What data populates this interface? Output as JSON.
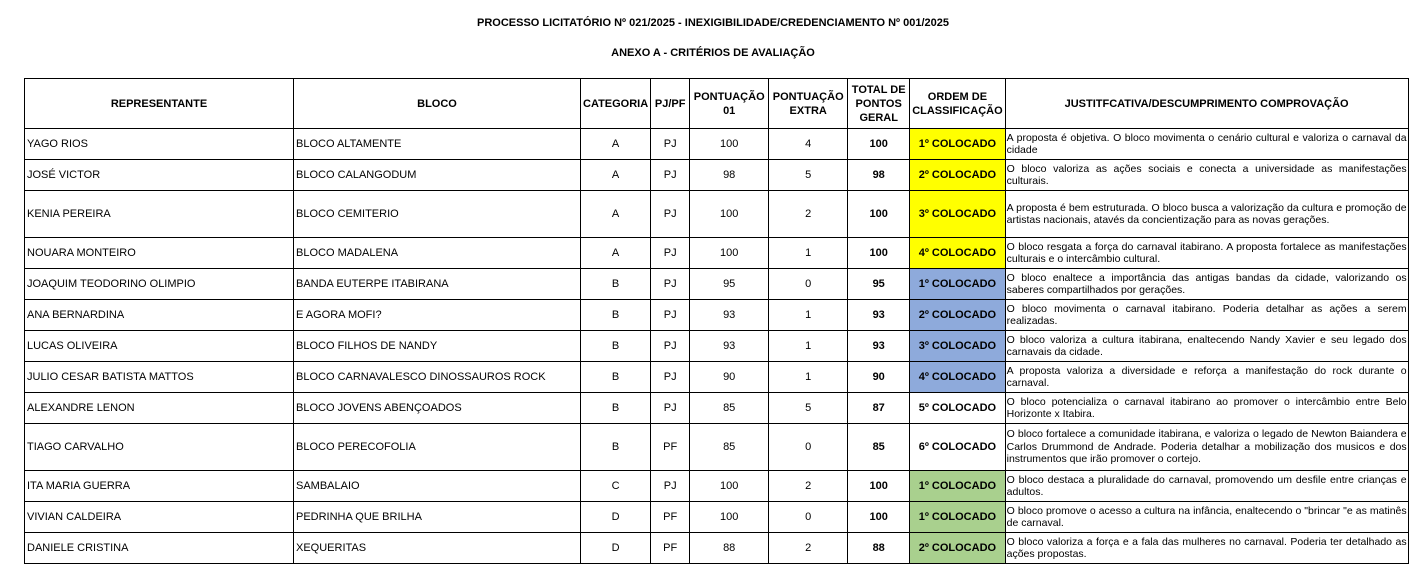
{
  "document": {
    "title": "PROCESSO LICITATÓRIO Nº 021/2025 - INEXIGIBILIDADE/CREDENCIAMENTO Nº 001/2025",
    "subtitle": "ANEXO A  -  CRITÉRIOS DE AVALIAÇÃO"
  },
  "table": {
    "headers": {
      "representante": "REPRESENTANTE",
      "bloco": "BLOCO",
      "categoria": "CATEGORIA",
      "pj_pf": "PJ/PF",
      "pontuacao_01": "PONTUAÇÃO 01",
      "pontuacao_extra": "PONTUAÇÃO EXTRA",
      "total": "TOTAL DE PONTOS GERAL",
      "ordem": "ORDEM DE CLASSIFICAÇÃO",
      "justificativa": "JUSTITFCATIVA/DESCUMPRIMENTO COMPROVAÇÃO"
    },
    "rank_colors": {
      "yellow": "#ffff00",
      "blue": "#8eaadb",
      "green": "#a9d08e",
      "none": "#ffffff"
    },
    "rows": [
      {
        "representante": "YAGO RIOS",
        "bloco": "BLOCO ALTAMENTE",
        "categoria": "A",
        "pj_pf": "PJ",
        "pontuacao_01": "100",
        "pontuacao_extra": "4",
        "total": "100",
        "ordem": "1º COLOCADO",
        "rank_color": "yellow",
        "justificativa": "A proposta é objetiva. O bloco movimenta o cenário cultural e valoriza o carnaval da cidade"
      },
      {
        "representante": "JOSÉ VICTOR",
        "bloco": "BLOCO CALANGODUM",
        "categoria": "A",
        "pj_pf": "PJ",
        "pontuacao_01": "98",
        "pontuacao_extra": "5",
        "total": "98",
        "ordem": "2º COLOCADO",
        "rank_color": "yellow",
        "justificativa": "O bloco valoriza as ações sociais e conecta a universidade as manifestações culturais."
      },
      {
        "representante": "KENIA PEREIRA",
        "bloco": "BLOCO CEMITERIO",
        "categoria": "A",
        "pj_pf": "PJ",
        "pontuacao_01": "100",
        "pontuacao_extra": "2",
        "total": "100",
        "ordem": "3º COLOCADO",
        "rank_color": "yellow",
        "justificativa": " A proposta é bem estruturada. O bloco busca a valorização da cultura e promoção de artistas nacionais, atavés da concientização para as novas gerações."
      },
      {
        "representante": "NOUARA MONTEIRO",
        "bloco": "BLOCO MADALENA",
        "categoria": "A",
        "pj_pf": "PJ",
        "pontuacao_01": "100",
        "pontuacao_extra": "1",
        "total": "100",
        "ordem": "4º COLOCADO",
        "rank_color": "yellow",
        "justificativa": "O bloco resgata a força do carnaval itabirano. A proposta fortalece as manifestações culturais  e o intercâmbio cultural."
      },
      {
        "representante": "JOAQUIM TEODORINO OLIMPIO",
        "bloco": "BANDA EUTERPE ITABIRANA",
        "categoria": "B",
        "pj_pf": "PJ",
        "pontuacao_01": "95",
        "pontuacao_extra": "0",
        "total": "95",
        "ordem": "1º COLOCADO",
        "rank_color": "blue",
        "justificativa": "O bloco enaltece a importância das antigas bandas da cidade, valorizando os saberes compartilhados  por gerações."
      },
      {
        "representante": "ANA BERNARDINA",
        "bloco": "E AGORA MOFI?",
        "categoria": "B",
        "pj_pf": "PJ",
        "pontuacao_01": "93",
        "pontuacao_extra": "1",
        "total": "93",
        "ordem": "2º COLOCADO",
        "rank_color": "blue",
        "justificativa": "O bloco movimenta o carnaval itabirano. Poderia detalhar as ações a serem realizadas."
      },
      {
        "representante": "LUCAS OLIVEIRA",
        "bloco": "BLOCO FILHOS DE NANDY",
        "categoria": "B",
        "pj_pf": "PJ",
        "pontuacao_01": "93",
        "pontuacao_extra": "1",
        "total": "93",
        "ordem": "3º COLOCADO",
        "rank_color": "blue",
        "justificativa": "O bloco valoriza a cultura itabirana, enaltecendo Nandy Xavier e seu legado dos carnavais da cidade."
      },
      {
        "representante": "JULIO CESAR BATISTA MATTOS",
        "bloco": "BLOCO CARNAVALESCO DINOSSAUROS ROCK",
        "categoria": "B",
        "pj_pf": "PJ",
        "pontuacao_01": "90",
        "pontuacao_extra": "1",
        "total": "90",
        "ordem": "4º COLOCADO",
        "rank_color": "blue",
        "justificativa": "A proposta valoriza a diversidade e reforça a manifestação do rock durante o carnaval."
      },
      {
        "representante": "ALEXANDRE LENON",
        "bloco": "BLOCO JOVENS ABENÇOADOS",
        "categoria": "B",
        "pj_pf": "PJ",
        "pontuacao_01": "85",
        "pontuacao_extra": "5",
        "total": "87",
        "ordem": "5º COLOCADO",
        "rank_color": "none",
        "justificativa": "O bloco potencializa o carnaval itabirano ao promover o intercâmbio entre Belo Horizonte x Itabira."
      },
      {
        "representante": "TIAGO CARVALHO",
        "bloco": "BLOCO PERECOFOLIA",
        "categoria": "B",
        "pj_pf": "PF",
        "pontuacao_01": "85",
        "pontuacao_extra": "0",
        "total": "85",
        "ordem": "6º COLOCADO",
        "rank_color": "none",
        "justificativa": "O bloco fortalece a comunidade itabirana, e valoriza o legado de Newton Baiandera e Carlos Drummond de Andrade. Poderia detalhar a mobilização dos musicos e dos instrumentos que irão promover o cortejo."
      },
      {
        "representante": "ITA MARIA GUERRA",
        "bloco": "SAMBALAIO",
        "categoria": "C",
        "pj_pf": "PJ",
        "pontuacao_01": "100",
        "pontuacao_extra": "2",
        "total": "100",
        "ordem": "1º COLOCADO",
        "rank_color": "green",
        "justificativa": "O bloco destaca a pluralidade do carnaval, promovendo um desfile entre crianças e adultos."
      },
      {
        "representante": "VIVIAN CALDEIRA",
        "bloco": "PEDRINHA QUE BRILHA",
        "categoria": "D",
        "pj_pf": "PF",
        "pontuacao_01": "100",
        "pontuacao_extra": "0",
        "total": "100",
        "ordem": "1º COLOCADO",
        "rank_color": "green",
        "justificativa": "O bloco promove o acesso a cultura na infância, enaltecendo o \"brincar \"e as matinês de carnaval."
      },
      {
        "representante": "DANIELE CRISTINA",
        "bloco": "XEQUERITAS",
        "categoria": "D",
        "pj_pf": "PF",
        "pontuacao_01": "88",
        "pontuacao_extra": "2",
        "total": "88",
        "ordem": "2º COLOCADO",
        "rank_color": "green",
        "justificativa": "O bloco valoriza a força e a fala das mulheres no carnaval. Poderia ter detalhado as ações propostas."
      }
    ]
  }
}
